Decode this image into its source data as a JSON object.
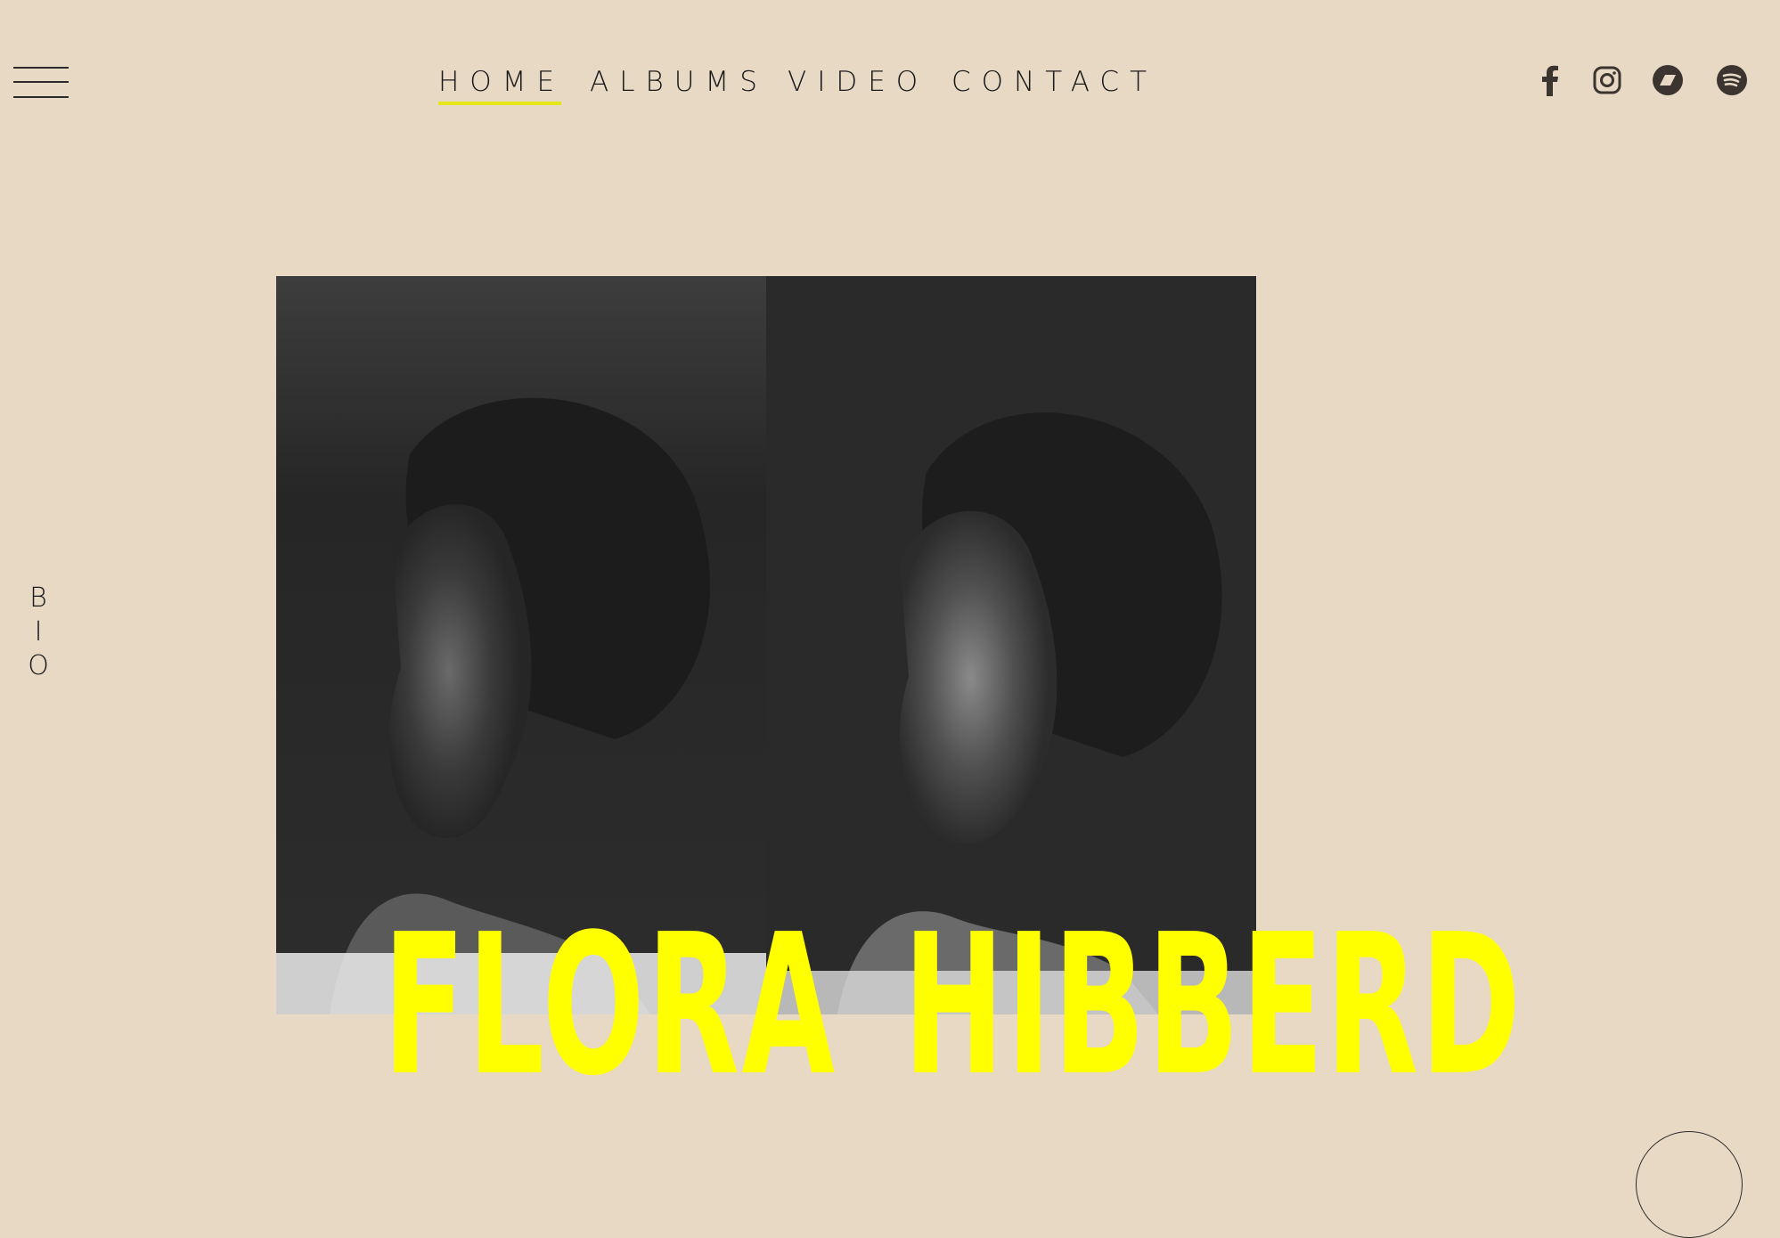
{
  "nav": {
    "items": [
      {
        "label": "HOME",
        "active": true
      },
      {
        "label": "ALBUMS",
        "active": false
      },
      {
        "label": "VIDEO",
        "active": false
      },
      {
        "label": "CONTACT",
        "active": false
      }
    ]
  },
  "socials": [
    "facebook-icon",
    "instagram-icon",
    "bandcamp-icon",
    "spotify-icon"
  ],
  "side_link": {
    "letters": [
      "B",
      "I",
      "O"
    ]
  },
  "hero": {
    "first_name": "FLORA",
    "last_name": "HIBBERD"
  },
  "colors": {
    "background": "#e8d9c5",
    "accent": "#ffff00",
    "nav_underline": "#e4e61a",
    "icons": "#3b342f"
  }
}
